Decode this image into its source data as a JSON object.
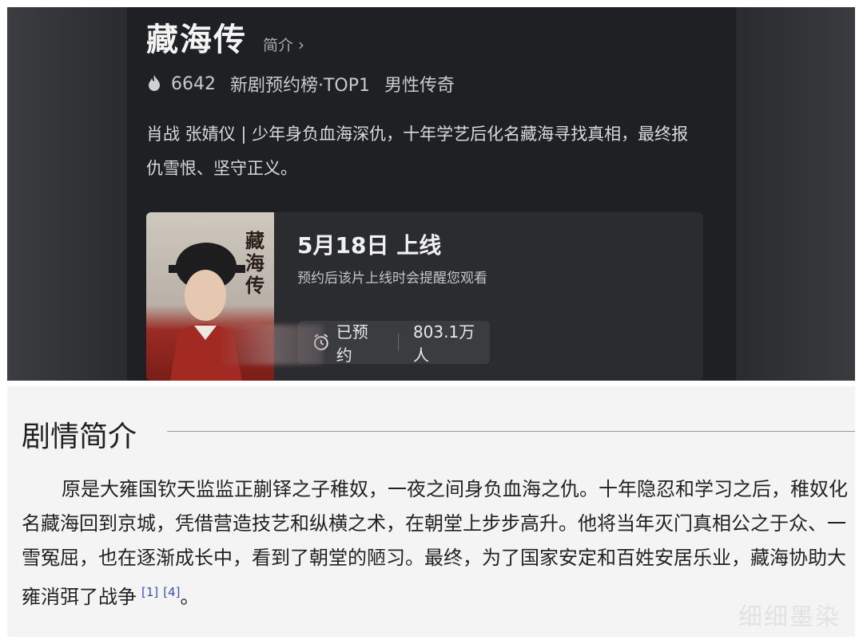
{
  "top": {
    "title": "藏海传",
    "intro_link": "简介",
    "heat": "6642",
    "rank": "新剧预约榜·TOP1",
    "genre": "男性传奇",
    "description": "肖战 张婧仪 | 少年身负血海深仇，十年学艺后化名藏海寻找真相，最终报仇雪恨、坚守正义。",
    "poster_text": "藏海传",
    "release_title": "5月18日 上线",
    "release_sub": "预约后该片上线时会提醒您观看",
    "reserved_label": "已预约",
    "reserved_count": "803.1万人"
  },
  "wiki": {
    "heading": "剧情简介",
    "body": "原是大雍国钦天监监正蒯铎之子稚奴，一夜之间身负血海之仇。十年隐忍和学习之后，稚奴化名藏海回到京城，凭借营造技艺和纵横之术，在朝堂上步步高升。他将当年灭门真相公之于众、一雪冤屈，也在逐渐成长中，看到了朝堂的陋习。最终，为了国家安定和百姓安居乐业，藏海协助大雍消弭了战争",
    "cite1": "[1]",
    "cite2": "[4]",
    "end_punct": "。"
  },
  "watermark": "细细墨染"
}
